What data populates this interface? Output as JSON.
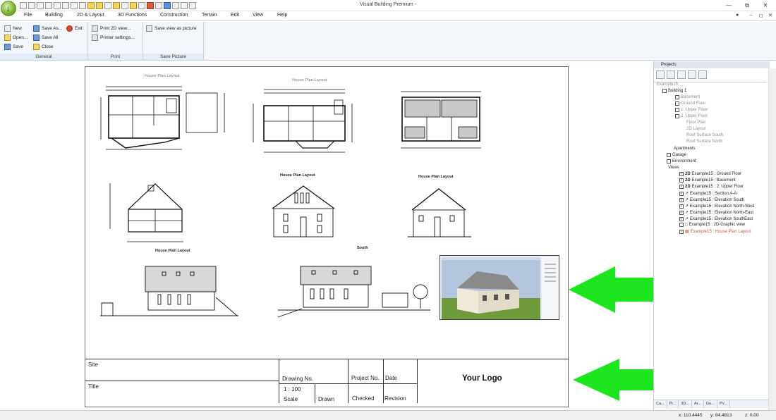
{
  "window": {
    "title": "Visual Building Premium -",
    "minimize": "—",
    "restore": "⧉",
    "close": "✕"
  },
  "menu": {
    "items": [
      "File",
      "Building",
      "2D & Layout",
      "3D Functions",
      "Construction",
      "Terrain",
      "Edit",
      "View",
      "Help"
    ]
  },
  "ribbon": {
    "general": {
      "label": "General",
      "new": "New",
      "open": "Open...",
      "save": "Save",
      "save_as": "Save As...",
      "save_all": "Save All",
      "close": "Close",
      "exit": "Exit"
    },
    "print": {
      "label": "Print",
      "print_2d": "Print 2D view...",
      "printer_settings": "Printer settings..."
    },
    "save_picture": {
      "label": "Save Picture",
      "save_view": "Save view as picture"
    }
  },
  "sheet": {
    "labels": {
      "plan1": "House Plan Layout",
      "plan2": "House Plan Layout",
      "elev2": "House Plan Layout",
      "elev3": "House Plan Layout",
      "row3a": "House Plan Layout",
      "row3b": "South"
    },
    "title_block": {
      "site": "Site",
      "title": "Title",
      "drawing_no": "Drawing No.",
      "project_no": "Project No.",
      "date": "Date",
      "scale_value": "1 : 100",
      "scale": "Scale",
      "drawn": "Drawn",
      "checked": "Checked",
      "revision": "Revision",
      "logo": "Your Logo"
    }
  },
  "projects": {
    "title": "Projects",
    "tree": {
      "root": "Example15",
      "building": "Building 1",
      "basement": "Basement",
      "ground": "Ground Floor",
      "upper1": "1. Upper Floor",
      "upper2": "2. Upper Floor",
      "floor_plan": "Floor Plan",
      "layout_2d": "2D Layout",
      "roof_south": "Roof Surface South",
      "roof_north": "Roof Surface North",
      "apartments": "Apartments",
      "garage": "Garage",
      "environment": "Environment",
      "views": "Views",
      "tag2d": "2D",
      "v1": "Example15 : Ground Floor",
      "v2": "Example15 : Basement",
      "v3": "Example15 : 2. Upper Floor",
      "v4": "Example15 : Section A-A",
      "v5": "Example15 : Elevation South",
      "v6": "Example15 : Elevation North-West",
      "v7": "Example15 : Elevation North-East",
      "v8": "Example15 : Elevation SouthEast",
      "v9": "Example15 : 2D-Graphic view",
      "v10": "Example15 : House Plan Layout"
    },
    "tabs": [
      "Ca...",
      "Pr...",
      "3D...",
      "Ar...",
      "Gu...",
      "PV..."
    ]
  },
  "status": {
    "x": "x: 110.4445",
    "y": "y: 84.4813",
    "z": "z: 0.00"
  },
  "colors": {
    "arrow": "#1ee61e",
    "ribbon": "#f3f6fa"
  }
}
